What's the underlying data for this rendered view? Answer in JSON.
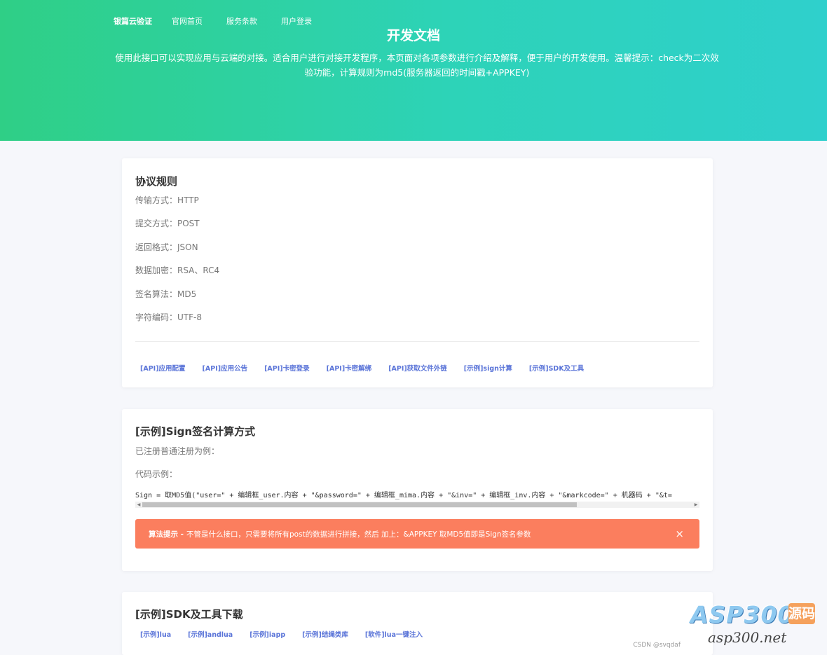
{
  "nav": {
    "brand": "银篇云验证",
    "items": [
      "官网首页",
      "服务条款",
      "用户登录"
    ]
  },
  "hero": {
    "title": "开发文档",
    "desc_line1": "使用此接口可以实现应用与云端的对接。适合用户进行对接开发程序，本页面对各项参数进行介绍及解释，便于用户的开发使用。温馨提示：check为二次效",
    "desc_line2": "验功能，计算规则为md5(服务器返回的时间戳+APPKEY)"
  },
  "protocol": {
    "title": "协议规则",
    "rows": [
      "传输方式：HTTP",
      "提交方式：POST",
      "返回格式：JSON",
      "数据加密：RSA、RC4",
      "签名算法：MD5",
      "字符编码：UTF-8"
    ],
    "links": [
      "[API]应用配置",
      "[API]应用公告",
      "[API]卡密登录",
      "[API]卡密解绑",
      "[API]获取文件外链",
      "[示例]sign计算",
      "[示例]SDK及工具"
    ]
  },
  "sign": {
    "title": "[示例]Sign签名计算方式",
    "subtitle": "已注册普通注册为例：",
    "code_label": "代码示例：",
    "code": "Sign = 取MD5值(\"user=\" + 编辑框_user.内容 + \"&password=\" + 编辑框_mima.内容 + \"&inv=\" + 编辑框_inv.内容 + \"&markcode=\" + 机器码 + \"&t=",
    "alert_bold": "算法提示 -",
    "alert_text": "不管是什么接口，只需要将所有post的数据进行拼接，然后 加上：&APPKEY 取MD5值即是Sign签名参数",
    "alert_close": "×"
  },
  "sdk": {
    "title": "[示例]SDK及工具下载",
    "links": [
      "[示例]lua",
      "[示例]andlua",
      "[示例]iapp",
      "[示例]结绳类库",
      "[软件]lua一键注入"
    ],
    "credit": "CSDN @svqdaf"
  },
  "watermark": {
    "asp": "ASP300",
    "box": "源码",
    "url": "asp300.net"
  },
  "colors": {
    "hero_start": "#2fcf86",
    "hero_end": "#2fd0cc",
    "link": "#5a74d8",
    "alert": "#fb7e5e"
  }
}
